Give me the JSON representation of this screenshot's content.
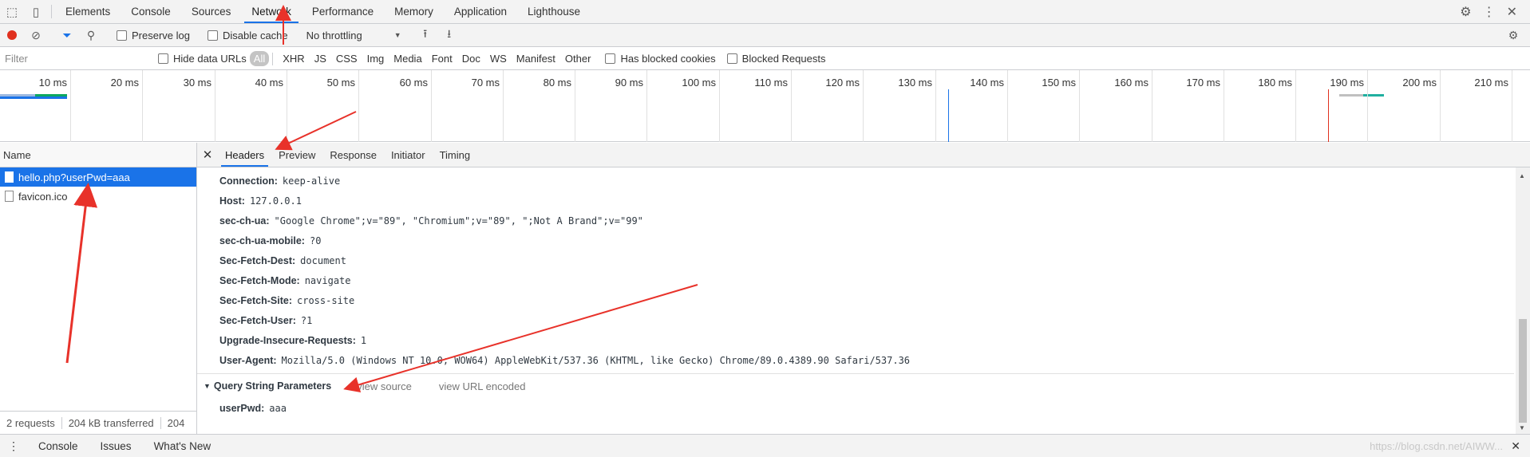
{
  "top_tabs": [
    "Elements",
    "Console",
    "Sources",
    "Network",
    "Performance",
    "Memory",
    "Application",
    "Lighthouse"
  ],
  "toolbar": {
    "preserve_log": "Preserve log",
    "disable_cache": "Disable cache",
    "throttling": "No throttling"
  },
  "filter": {
    "placeholder": "Filter",
    "hide_data_urls": "Hide data URLs",
    "types": [
      "All",
      "XHR",
      "JS",
      "CSS",
      "Img",
      "Media",
      "Font",
      "Doc",
      "WS",
      "Manifest",
      "Other"
    ],
    "has_blocked_cookies": "Has blocked cookies",
    "blocked_requests": "Blocked Requests"
  },
  "timeline": {
    "ticks": [
      "10 ms",
      "20 ms",
      "30 ms",
      "40 ms",
      "50 ms",
      "60 ms",
      "70 ms",
      "80 ms",
      "90 ms",
      "100 ms",
      "110 ms",
      "120 ms",
      "130 ms",
      "140 ms",
      "150 ms",
      "160 ms",
      "170 ms",
      "180 ms",
      "190 ms",
      "200 ms",
      "210 ms"
    ]
  },
  "requests": {
    "header": "Name",
    "items": [
      "hello.php?userPwd=aaa",
      "favicon.ico"
    ],
    "status": {
      "count": "2 requests",
      "transferred": "204 kB transferred",
      "resources": "204"
    }
  },
  "detail": {
    "tabs": [
      "Headers",
      "Preview",
      "Response",
      "Initiator",
      "Timing"
    ],
    "headers": [
      {
        "name": "Connection:",
        "value": "keep-alive"
      },
      {
        "name": "Host:",
        "value": "127.0.0.1"
      },
      {
        "name": "sec-ch-ua:",
        "value": "\"Google Chrome\";v=\"89\", \"Chromium\";v=\"89\", \";Not A Brand\";v=\"99\""
      },
      {
        "name": "sec-ch-ua-mobile:",
        "value": "?0"
      },
      {
        "name": "Sec-Fetch-Dest:",
        "value": "document"
      },
      {
        "name": "Sec-Fetch-Mode:",
        "value": "navigate"
      },
      {
        "name": "Sec-Fetch-Site:",
        "value": "cross-site"
      },
      {
        "name": "Sec-Fetch-User:",
        "value": "?1"
      },
      {
        "name": "Upgrade-Insecure-Requests:",
        "value": "1"
      },
      {
        "name": "User-Agent:",
        "value": "Mozilla/5.0 (Windows NT 10.0; WOW64) AppleWebKit/537.36 (KHTML, like Gecko) Chrome/89.0.4389.90 Safari/537.36"
      }
    ],
    "query_section": {
      "title": "Query String Parameters",
      "view_source": "view source",
      "view_url_encoded": "view URL encoded",
      "params": [
        {
          "name": "userPwd:",
          "value": "aaa"
        }
      ]
    }
  },
  "drawer": {
    "tabs": [
      "Console",
      "Issues",
      "What's New"
    ]
  },
  "watermark": "https://blog.csdn.net/AIWW...",
  "colors": {
    "accent": "#1a73e8",
    "record": "#e0301e",
    "annotation": "#e8322a"
  }
}
